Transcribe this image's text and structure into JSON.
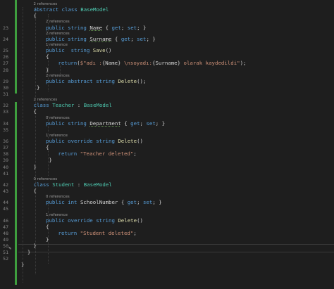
{
  "editor": {
    "language": "C#",
    "colors": {
      "background": "#1e1e1e",
      "keyword": "#569cd6",
      "type": "#4ec9b0",
      "method": "#dcdcaa",
      "string": "#ce9178",
      "text": "#d4d4d4",
      "line_number": "#858585",
      "codelens": "#9e9e9e",
      "change_bar": "#3e9e3e"
    },
    "gutter_icon": "pencil-icon",
    "lines": [
      {
        "n": "",
        "lens": "2 references",
        "indent": 1
      },
      {
        "n": "",
        "indent": 1,
        "tokens": [
          [
            "kw",
            "abstract "
          ],
          [
            "kw",
            "class "
          ],
          [
            "type",
            "BaseModel"
          ]
        ]
      },
      {
        "n": "",
        "indent": 1,
        "tokens": [
          [
            "t",
            "{"
          ]
        ]
      },
      {
        "n": "23",
        "lens": "2 references",
        "indent": 2,
        "tokens": [
          [
            "kw",
            "public "
          ],
          [
            "kw",
            "string "
          ],
          [
            "sq",
            "Name"
          ],
          [
            "t",
            " { "
          ],
          [
            "kw",
            "get"
          ],
          [
            "t",
            "; "
          ],
          [
            "kw",
            "set"
          ],
          [
            "t",
            "; }"
          ]
        ]
      },
      {
        "n": "24",
        "lens": "2 references",
        "indent": 2,
        "tokens": [
          [
            "kw",
            "public "
          ],
          [
            "kw",
            "string "
          ],
          [
            "sq",
            "Surname"
          ],
          [
            "t",
            " { "
          ],
          [
            "kw",
            "get"
          ],
          [
            "t",
            "; "
          ],
          [
            "kw",
            "set"
          ],
          [
            "t",
            "; }"
          ]
        ]
      },
      {
        "n": "25",
        "lens": "1 reference",
        "indent": 2,
        "tokens": [
          [
            "kw",
            "public "
          ],
          [
            "kw",
            " string "
          ],
          [
            "meth",
            "Save"
          ],
          [
            "t",
            "()"
          ]
        ]
      },
      {
        "n": "26",
        "indent": 2,
        "tokens": [
          [
            "t",
            "{"
          ]
        ]
      },
      {
        "n": "27",
        "indent": 3,
        "tokens": [
          [
            "kw",
            "return"
          ],
          [
            "t",
            "("
          ],
          [
            "str",
            "$\"adı :"
          ],
          [
            "t",
            "{Name}"
          ],
          [
            "str",
            " \\nsoyadı:"
          ],
          [
            "t",
            "{Surname}"
          ],
          [
            "str",
            " olarak kaydedildi\""
          ],
          [
            "t",
            ");"
          ]
        ]
      },
      {
        "n": "28",
        "indent": 2,
        "tokens": [
          [
            "t",
            "}"
          ]
        ]
      },
      {
        "n": "29",
        "lens": "2 references",
        "indent": 2,
        "tokens": [
          [
            "kw",
            "public "
          ],
          [
            "kw",
            "abstract "
          ],
          [
            "kw",
            "string "
          ],
          [
            "meth",
            "Delete"
          ],
          [
            "t",
            "();"
          ]
        ]
      },
      {
        "n": "30",
        "indent": 1,
        "tokens": [
          [
            "t",
            " }"
          ]
        ]
      },
      {
        "n": "31",
        "indent": 0
      },
      {
        "n": "32",
        "lens": "2 references",
        "indent": 1,
        "tokens": [
          [
            "kw",
            "class "
          ],
          [
            "type",
            "Teacher"
          ],
          [
            "t",
            " : "
          ],
          [
            "type",
            "BaseModel"
          ]
        ]
      },
      {
        "n": "33",
        "indent": 1,
        "tokens": [
          [
            "t",
            "{"
          ]
        ]
      },
      {
        "n": "34",
        "lens": "0 references",
        "indent": 2,
        "tokens": [
          [
            "kw",
            "public "
          ],
          [
            "kw",
            "string "
          ],
          [
            "sq",
            "Department"
          ],
          [
            "t",
            " { "
          ],
          [
            "kw",
            "get"
          ],
          [
            "t",
            "; "
          ],
          [
            "kw",
            "set"
          ],
          [
            "t",
            "; }"
          ]
        ]
      },
      {
        "n": "35",
        "indent": 0
      },
      {
        "n": "36",
        "lens": "1 reference",
        "indent": 2,
        "tokens": [
          [
            "kw",
            "public "
          ],
          [
            "kw",
            "override "
          ],
          [
            "kw",
            "string "
          ],
          [
            "meth",
            "Delete"
          ],
          [
            "t",
            "()"
          ]
        ]
      },
      {
        "n": "37",
        "indent": 2,
        "tokens": [
          [
            "t",
            "{"
          ]
        ]
      },
      {
        "n": "38",
        "indent": 3,
        "tokens": [
          [
            "kw",
            "return "
          ],
          [
            "str",
            "\"Teacher deleted\""
          ],
          [
            "t",
            ";"
          ]
        ]
      },
      {
        "n": "39",
        "indent": 2,
        "tokens": [
          [
            "t",
            " }"
          ]
        ]
      },
      {
        "n": "40",
        "indent": 1,
        "tokens": [
          [
            "t",
            "}"
          ]
        ]
      },
      {
        "n": "41",
        "indent": 0
      },
      {
        "n": "42",
        "lens": "0 references",
        "indent": 1,
        "tokens": [
          [
            "kw",
            "class "
          ],
          [
            "type",
            "Student"
          ],
          [
            "t",
            " : "
          ],
          [
            "type",
            "BaseModel"
          ]
        ]
      },
      {
        "n": "43",
        "indent": 1,
        "tokens": [
          [
            "t",
            "{"
          ]
        ]
      },
      {
        "n": "44",
        "lens": "0 references",
        "indent": 2,
        "tokens": [
          [
            "kw",
            "public "
          ],
          [
            "kw",
            "int "
          ],
          [
            "t",
            "SchoolNumber { "
          ],
          [
            "kw",
            "get"
          ],
          [
            "t",
            "; "
          ],
          [
            "kw",
            "set"
          ],
          [
            "t",
            "; }"
          ]
        ]
      },
      {
        "n": "45",
        "indent": 0
      },
      {
        "n": "46",
        "lens": "1 reference",
        "indent": 2,
        "tokens": [
          [
            "kw",
            "public "
          ],
          [
            "kw",
            "override "
          ],
          [
            "kw",
            "string "
          ],
          [
            "meth",
            "Delete"
          ],
          [
            "t",
            "()"
          ]
        ]
      },
      {
        "n": "47",
        "indent": 2,
        "tokens": [
          [
            "t",
            "{"
          ]
        ]
      },
      {
        "n": "48",
        "indent": 3,
        "tokens": [
          [
            "kw",
            "return "
          ],
          [
            "str",
            "\"Student deleted\""
          ],
          [
            "t",
            ";"
          ]
        ]
      },
      {
        "n": "49",
        "indent": 2,
        "tokens": [
          [
            "t",
            "}"
          ]
        ]
      },
      {
        "n": "50",
        "indent": 1,
        "tokens": [
          [
            "t",
            "}"
          ]
        ]
      },
      {
        "n": "51",
        "indent": 0,
        "tokens": [
          [
            "t",
            "  }"
          ]
        ]
      },
      {
        "n": "52",
        "indent": 0
      },
      {
        "n": "",
        "indent": 0,
        "tokens": [
          [
            "t",
            "}"
          ]
        ]
      }
    ]
  }
}
